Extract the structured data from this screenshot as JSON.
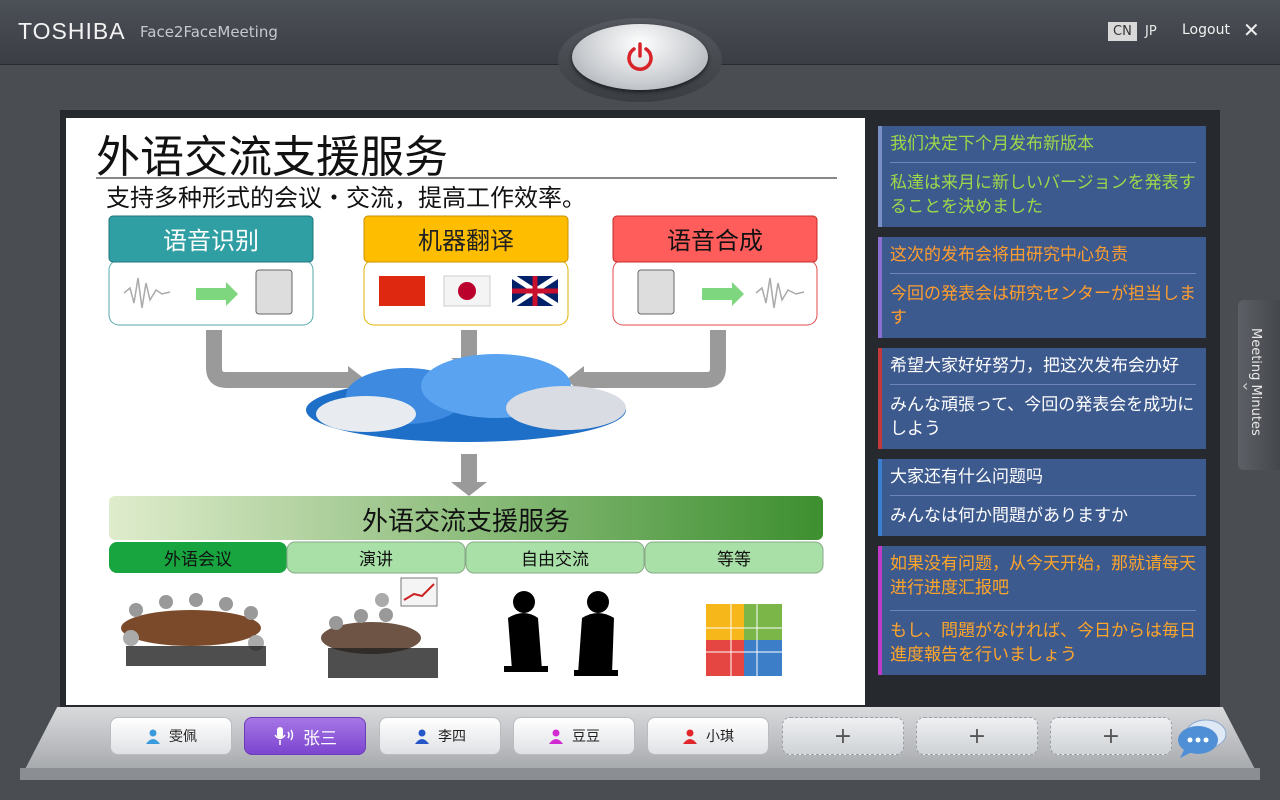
{
  "header": {
    "brand": "TOSHIBA",
    "app_name": "Face2FaceMeeting",
    "lang_cn": "CN",
    "lang_jp": "JP",
    "logout": "Logout",
    "close": "✕"
  },
  "slide": {
    "title": "外语交流支援服务",
    "subtitle": "支持多种形式的会议・交流，提高工作效率。",
    "box1": "语音识别",
    "box2": "机器翻译",
    "box3": "语音合成",
    "service_bar": "外语交流支援服务",
    "tabs": [
      "外语会议",
      "演讲",
      "自由交流",
      "等等"
    ]
  },
  "messages": [
    {
      "zh": "我们决定下个月发布新版本",
      "jp": "私達は来月に新しいバージョンを発表することを決めました",
      "color": "#9ed84a"
    },
    {
      "zh": "这次的发布会将由研究中心负责",
      "jp": "今回の発表会は研究センターが担当します",
      "color": "#ff9d2e"
    },
    {
      "zh": "希望大家好好努力，把这次发布会办好",
      "jp": "みんな頑張って、今回の発表会を成功にしよう",
      "color": "#ffffff"
    },
    {
      "zh": "大家还有什么问题吗",
      "jp": "みんなは何か問題がありますか",
      "color": "#ffffff"
    },
    {
      "zh": "如果没有问题，从今天开始，那就请每天进行进度汇报吧",
      "jp": "もし、問題がなければ、今日からは毎日進度報告を行いましょう",
      "color": "#ffa52a"
    }
  ],
  "minutes_tab": "Meeting Minutes",
  "participants": [
    {
      "name": "雯佩",
      "color": "#3a9bdc"
    },
    {
      "name": "张三",
      "color": "#ffffff",
      "active": true
    },
    {
      "name": "李四",
      "color": "#2456c8"
    },
    {
      "name": "豆豆",
      "color": "#d02ad0"
    },
    {
      "name": "小琪",
      "color": "#e0262b"
    }
  ],
  "add_label": "+"
}
